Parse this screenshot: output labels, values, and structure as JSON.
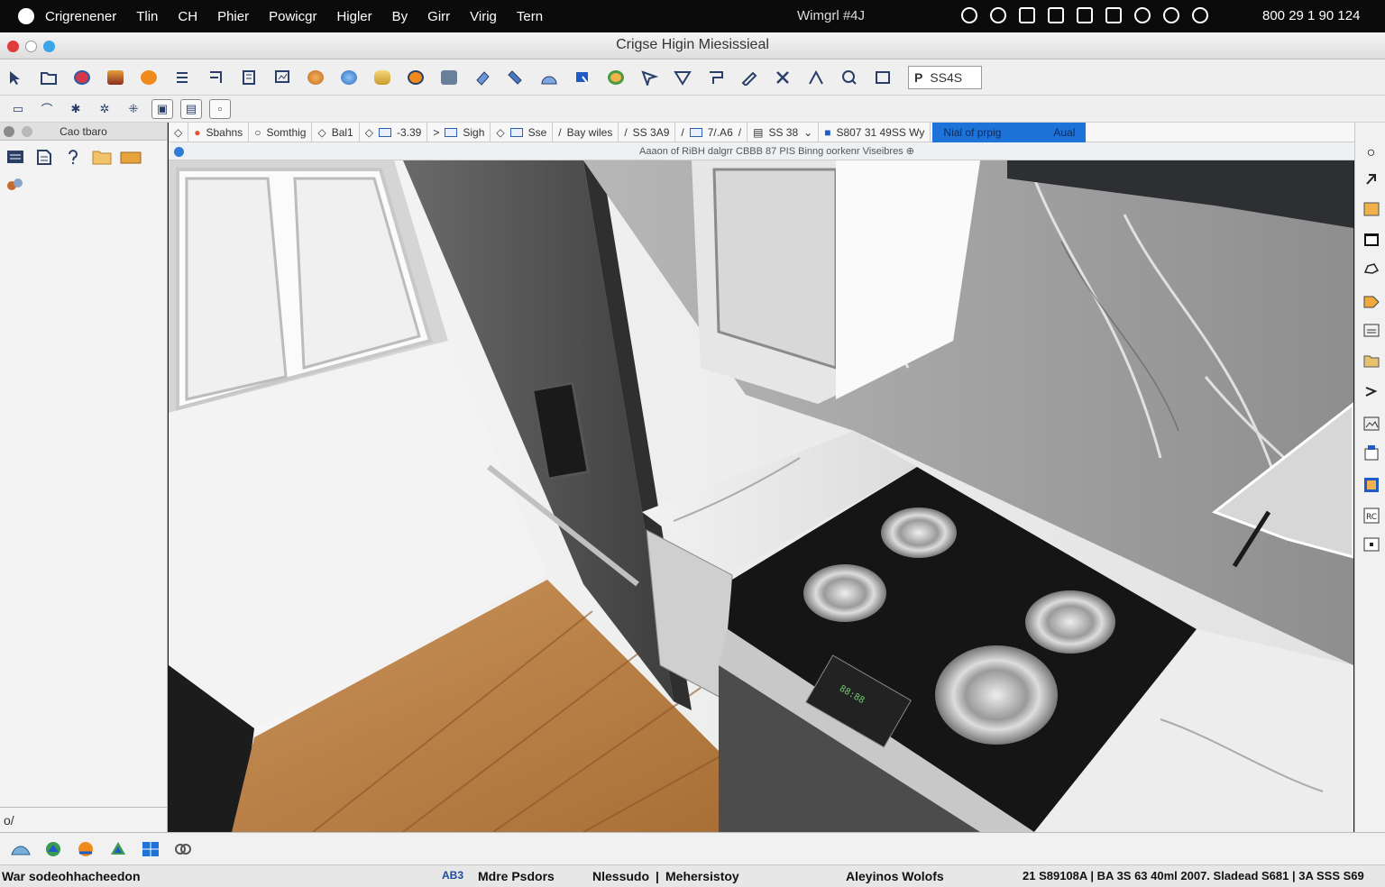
{
  "menubar": {
    "app_name": "Crigrenener",
    "items": [
      "Tlin",
      "CH",
      "Phier",
      "Powicgr",
      "Higler",
      "By",
      "Girr",
      "Virig",
      "Tern"
    ],
    "window_label": "Wimgrl  #4J",
    "clock": "800 29 1 90 124"
  },
  "titlebar": {
    "title": "Crigse Higin Miesissieal"
  },
  "toolbar": {
    "field_value": "SS4S"
  },
  "sidebar": {
    "header": "Cao tbaro",
    "footer": "o/"
  },
  "optionsbar": {
    "items": [
      {
        "label": "Sbahns"
      },
      {
        "label": "Somthig"
      },
      {
        "label": "Bal1"
      },
      {
        "label": "-3.39"
      },
      {
        "label": "Sigh"
      },
      {
        "label": "Sse"
      },
      {
        "label": "Bay wiles"
      },
      {
        "label": "SS 3A9"
      },
      {
        "label": "7/.A6"
      },
      {
        "label": "SS 38"
      },
      {
        "label": "S807 31 49SS Wy"
      }
    ],
    "highlight_left": "Nial of prpig",
    "highlight_right": "Aual"
  },
  "hint": {
    "text": "Aaaon of RiBH dalgrr CBBB 87 PIS Binng oorkenr Viseibres"
  },
  "statusbar": {
    "left": "War sodeohhacheedon",
    "badge": "AB3",
    "mode": "Mdre Psdors",
    "tool": "Nlessudo",
    "sep": "|",
    "layer": "Mehersistoy",
    "center": "Aleyinos Wolofs",
    "right": "21 S89108A | BA 3S 63 40ml 2007. Sladead S681 | 3A SSS S69"
  },
  "colors": {
    "accent": "#1e73d8",
    "menubar_bg": "#0b0b0b",
    "toolbar_bg": "#efefef"
  }
}
